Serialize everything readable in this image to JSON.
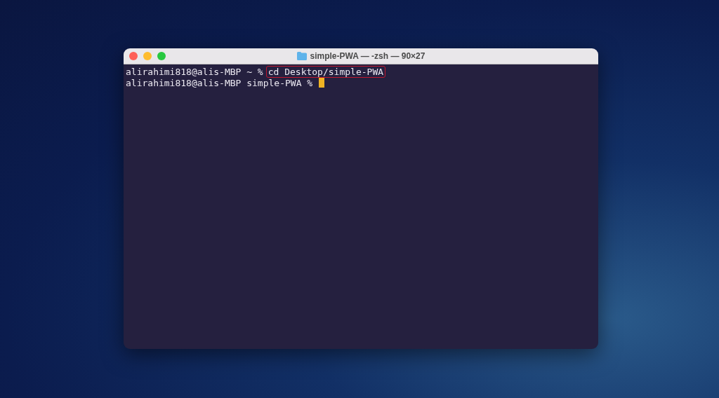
{
  "window": {
    "title": "simple-PWA — -zsh — 90×27"
  },
  "lines": [
    {
      "prompt": "alirahimi818@alis-MBP ~ %",
      "command": "cd Desktop/simple-PWA",
      "highlighted": true,
      "cursor": false
    },
    {
      "prompt": "alirahimi818@alis-MBP simple-PWA %",
      "cursor": true
    }
  ]
}
